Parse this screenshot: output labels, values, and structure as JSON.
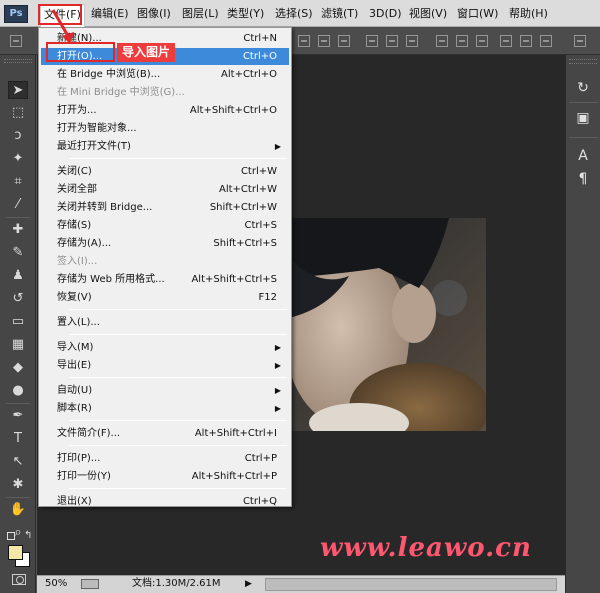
{
  "menubar": {
    "logo": "Ps",
    "items": [
      {
        "label": "文件(F)"
      },
      {
        "label": "编辑(E)"
      },
      {
        "label": "图像(I)"
      },
      {
        "label": "图层(L)"
      },
      {
        "label": "类型(Y)"
      },
      {
        "label": "选择(S)"
      },
      {
        "label": "滤镜(T)"
      },
      {
        "label": "3D(D)"
      },
      {
        "label": "视图(V)"
      },
      {
        "label": "窗口(W)"
      },
      {
        "label": "帮助(H)"
      }
    ]
  },
  "file_menu": {
    "items": [
      {
        "label": "新建(N)...",
        "shortcut": "Ctrl+N"
      },
      {
        "label": "打开(O)...",
        "shortcut": "Ctrl+O",
        "state": "highlighted"
      },
      {
        "label": "在 Bridge 中浏览(B)...",
        "shortcut": "Alt+Ctrl+O"
      },
      {
        "label": "在 Mini Bridge 中浏览(G)...",
        "shortcut": "",
        "state": "disabled"
      },
      {
        "label": "打开为...",
        "shortcut": "Alt+Shift+Ctrl+O"
      },
      {
        "label": "打开为智能对象...",
        "shortcut": ""
      },
      {
        "label": "最近打开文件(T)",
        "shortcut": "",
        "submenu": true
      },
      {
        "label": "关闭(C)",
        "shortcut": "Ctrl+W"
      },
      {
        "label": "关闭全部",
        "shortcut": "Alt+Ctrl+W"
      },
      {
        "label": "关闭并转到 Bridge...",
        "shortcut": "Shift+Ctrl+W"
      },
      {
        "label": "存储(S)",
        "shortcut": "Ctrl+S"
      },
      {
        "label": "存储为(A)...",
        "shortcut": "Shift+Ctrl+S"
      },
      {
        "label": "签入(I)...",
        "shortcut": "",
        "state": "disabled"
      },
      {
        "label": "存储为 Web 所用格式...",
        "shortcut": "Alt+Shift+Ctrl+S"
      },
      {
        "label": "恢复(V)",
        "shortcut": "F12"
      },
      {
        "label": "置入(L)...",
        "shortcut": ""
      },
      {
        "label": "导入(M)",
        "shortcut": "",
        "submenu": true
      },
      {
        "label": "导出(E)",
        "shortcut": "",
        "submenu": true
      },
      {
        "label": "自动(U)",
        "shortcut": "",
        "submenu": true
      },
      {
        "label": "脚本(R)",
        "shortcut": "",
        "submenu": true
      },
      {
        "label": "文件简介(F)...",
        "shortcut": "Alt+Shift+Ctrl+I"
      },
      {
        "label": "打印(P)...",
        "shortcut": "Ctrl+P"
      },
      {
        "label": "打印一份(Y)",
        "shortcut": "Alt+Shift+Ctrl+P"
      },
      {
        "label": "退出(X)",
        "shortcut": "Ctrl+Q"
      }
    ],
    "submenu_arrow": "▶"
  },
  "annotation": {
    "callout": "导入图片"
  },
  "tools": [
    {
      "icon": "move-tool-icon",
      "glyph": "➤"
    },
    {
      "icon": "marquee-tool-icon",
      "glyph": "⬚"
    },
    {
      "icon": "lasso-tool-icon",
      "glyph": "ↄ"
    },
    {
      "icon": "quick-selection-tool-icon",
      "glyph": "✦"
    },
    {
      "icon": "crop-tool-icon",
      "glyph": "⌗"
    },
    {
      "icon": "eyedropper-tool-icon",
      "glyph": "⁄"
    },
    {
      "icon": "healing-brush-tool-icon",
      "glyph": "✚"
    },
    {
      "icon": "brush-tool-icon",
      "glyph": "✎"
    },
    {
      "icon": "clone-stamp-tool-icon",
      "glyph": "♟"
    },
    {
      "icon": "history-brush-tool-icon",
      "glyph": "↺"
    },
    {
      "icon": "eraser-tool-icon",
      "glyph": "▭"
    },
    {
      "icon": "gradient-tool-icon",
      "glyph": "▦"
    },
    {
      "icon": "blur-tool-icon",
      "glyph": "◆"
    },
    {
      "icon": "dodge-tool-icon",
      "glyph": "●"
    },
    {
      "icon": "pen-tool-icon",
      "glyph": "✒"
    },
    {
      "icon": "type-tool-icon",
      "glyph": "T"
    },
    {
      "icon": "path-selection-tool-icon",
      "glyph": "↖"
    },
    {
      "icon": "custom-shape-tool-icon",
      "glyph": "✱"
    },
    {
      "icon": "hand-tool-icon",
      "glyph": "✋"
    },
    {
      "icon": "zoom-tool-icon",
      "glyph": "⌕"
    }
  ],
  "panels": [
    {
      "icon": "history-panel-icon",
      "glyph": "↻"
    },
    {
      "icon": "3d-panel-icon",
      "glyph": "▣"
    },
    {
      "icon": "character-panel-icon",
      "glyph": "A"
    },
    {
      "icon": "paragraph-panel-icon",
      "glyph": "¶"
    }
  ],
  "status": {
    "zoom": "50%",
    "doc_size": "文档:1.30M/2.61M",
    "arrow": "▶"
  },
  "watermark": "www.leawo.cn",
  "colors": {
    "foreground": "#f4e7a8",
    "background": "#ffffff",
    "highlight": "#3c8ad9",
    "annotation_red": "#e0282a"
  }
}
